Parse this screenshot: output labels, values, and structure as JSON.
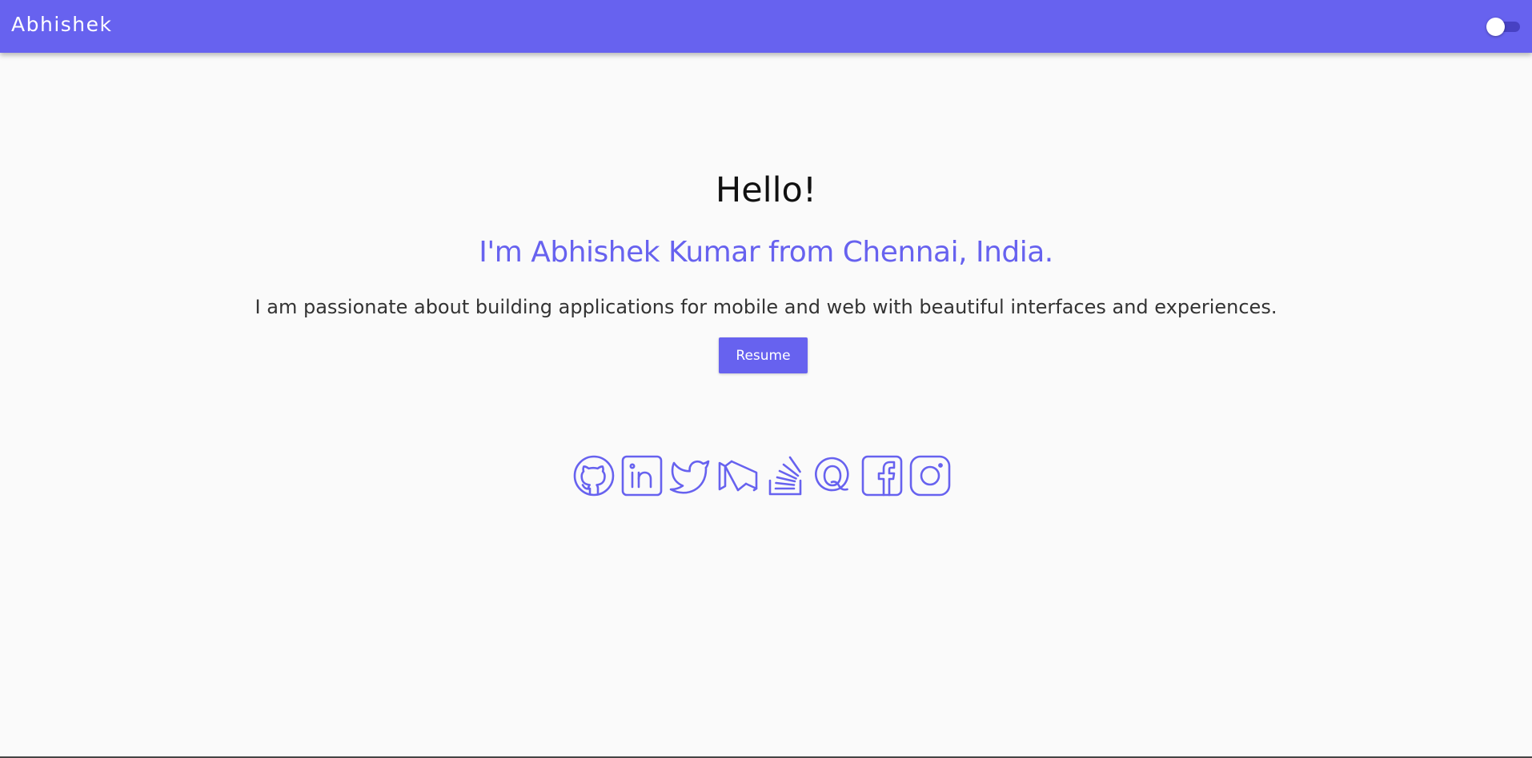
{
  "header": {
    "brand": "Abhishek",
    "theme_toggle": {
      "state": "off"
    },
    "background_color": "#6762ef"
  },
  "hero": {
    "greeting": "Hello!",
    "intro": "I'm Abhishek Kumar from Chennai, India.",
    "tagline": "I am passionate about building applications for mobile and web with beautiful interfaces and experiences.",
    "resume_label": "Resume",
    "accent_color": "#6762ef"
  },
  "social_links": [
    {
      "icon": "github-icon"
    },
    {
      "icon": "linkedin-icon"
    },
    {
      "icon": "twitter-icon"
    },
    {
      "icon": "medium-icon"
    },
    {
      "icon": "stackoverflow-icon"
    },
    {
      "icon": "quora-icon"
    },
    {
      "icon": "facebook-icon"
    },
    {
      "icon": "instagram-icon"
    }
  ]
}
